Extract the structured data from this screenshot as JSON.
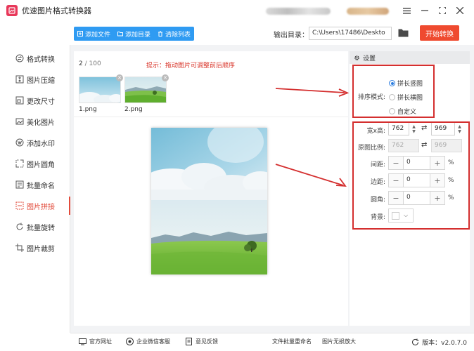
{
  "app": {
    "title": "优速图片格式转换器"
  },
  "toolbar": {
    "add_file": "添加文件",
    "add_folder": "添加目录",
    "clear_list": "清除列表",
    "output_label": "输出目录：",
    "output_path": "C:\\Users\\17486\\Deskto",
    "start": "开始转换"
  },
  "sidebar": {
    "items": [
      {
        "label": "格式转换",
        "icon": "format-icon"
      },
      {
        "label": "图片压缩",
        "icon": "compress-icon"
      },
      {
        "label": "更改尺寸",
        "icon": "resize-icon"
      },
      {
        "label": "美化图片",
        "icon": "beautify-icon"
      },
      {
        "label": "添加水印",
        "icon": "watermark-icon"
      },
      {
        "label": "图片圆角",
        "icon": "round-corner-icon"
      },
      {
        "label": "批量命名",
        "icon": "rename-icon"
      },
      {
        "label": "图片拼接",
        "icon": "stitch-icon",
        "active": true
      },
      {
        "label": "批量旋转",
        "icon": "rotate-icon"
      },
      {
        "label": "图片裁剪",
        "icon": "crop-icon"
      }
    ]
  },
  "main": {
    "count_current": "2",
    "count_sep": " / ",
    "count_total": "100",
    "hint": "提示：拖动图片可调整前后顺序",
    "files": [
      {
        "name": "1.png"
      },
      {
        "name": "2.png"
      }
    ]
  },
  "settings": {
    "title": "设置",
    "sort_label": "排序模式:",
    "sort_options": [
      {
        "label": "拼长竖图",
        "selected": true
      },
      {
        "label": "拼长横图",
        "selected": false
      },
      {
        "label": "自定义",
        "selected": false
      }
    ],
    "size_label": "宽x高:",
    "width": "762",
    "height": "969",
    "ratio_label": "原图比例:",
    "ratio_width": "762",
    "ratio_height": "969",
    "spacing_label": "间距:",
    "spacing": "0",
    "margin_label": "边距:",
    "margin": "0",
    "corner_label": "圆角:",
    "corner": "0",
    "percent": "%",
    "bg_label": "背景:",
    "bg_color": "#ffffff"
  },
  "footer": {
    "website": "官方网址",
    "wechat": "企业微信客服",
    "feedback": "意见反馈",
    "batch_rename": "文件批量重命名",
    "upscale": "图片无损放大",
    "version": "版本：v2.0.7.0"
  },
  "colors": {
    "accent": "#2f9bf2",
    "start": "#ef4a2f",
    "active": "#e24b3b",
    "annotation": "#d42f2f"
  }
}
